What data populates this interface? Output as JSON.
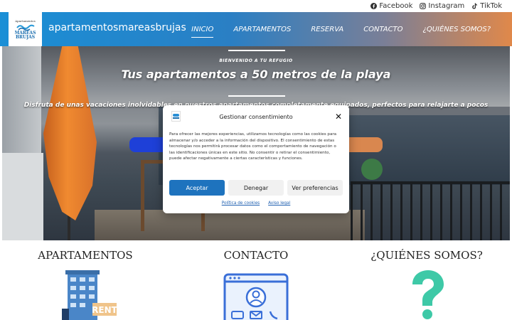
{
  "topbar": {
    "social": [
      {
        "label": "Facebook",
        "icon": "facebook-icon"
      },
      {
        "label": "Instagram",
        "icon": "instagram-icon"
      },
      {
        "label": "TikTok",
        "icon": "tiktok-icon"
      }
    ]
  },
  "header": {
    "logo_top": "Apartamentos",
    "logo_line1": "MAREAS",
    "logo_line2": "BRUJAS",
    "site_title": "apartamentosmareasbrujas",
    "nav": [
      {
        "label": "INICIO",
        "active": true
      },
      {
        "label": "APARTAMENTOS",
        "active": false
      },
      {
        "label": "RESERVA",
        "active": false
      },
      {
        "label": "CONTACTO",
        "active": false
      },
      {
        "label": "¿QUIÉNES SOMOS?",
        "active": false
      }
    ],
    "colors": {
      "gradient_start": "#1a8fd6",
      "gradient_end": "#e0884a"
    }
  },
  "hero": {
    "kicker": "BIENVENIDO A TU REFUGIO",
    "title": "Tus apartamentos a 50 metros de la playa",
    "subtitle": "Disfruta de unas vacaciones inolvidables en nuestros apartamentos completamente equipados, perfectos para relajarte a pocos"
  },
  "consent": {
    "title": "Gestionar consentimiento",
    "body": "Para ofrecer las mejores experiencias, utilizamos tecnologías como las cookies para almacenar y/o acceder a la información del dispositivo. El consentimiento de estas tecnologías nos permitirá procesar datos como el comportamiento de navegación o las identificaciones únicas en este sitio. No consentir o retirar el consentimiento, puede afectar negativamente a ciertas características y funciones.",
    "accept": "Aceptar",
    "deny": "Denegar",
    "preferences": "Ver preferencias",
    "link_cookies": "Política de cookies",
    "link_legal": "Aviso legal",
    "accent": "#1e73be"
  },
  "sections": [
    {
      "title": "APARTAMENTOS",
      "icon": "building-rent-icon"
    },
    {
      "title": "CONTACTO",
      "icon": "contact-card-icon"
    },
    {
      "title": "¿QUIÉNES SOMOS?",
      "icon": "question-mark-icon"
    }
  ]
}
